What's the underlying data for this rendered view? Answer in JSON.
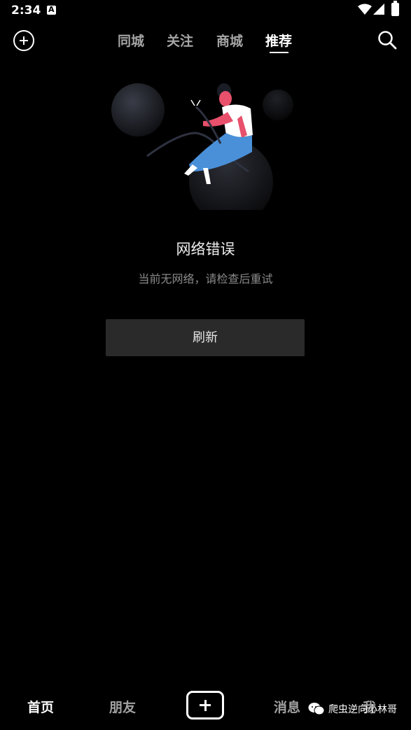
{
  "status_bar": {
    "time": "2:34",
    "notification_letter": "A"
  },
  "top_nav": {
    "tabs": [
      {
        "label": "同城",
        "active": false
      },
      {
        "label": "关注",
        "active": false
      },
      {
        "label": "商城",
        "active": false
      },
      {
        "label": "推荐",
        "active": true
      }
    ]
  },
  "error": {
    "title": "网络错误",
    "subtitle": "当前无网络，请检查后重试",
    "refresh_label": "刷新"
  },
  "bottom_nav": {
    "items": [
      {
        "label": "首页",
        "active": true
      },
      {
        "label": "朋友",
        "active": false
      },
      {
        "label": "消息",
        "active": false
      },
      {
        "label": "我",
        "active": false
      }
    ]
  },
  "watermark": {
    "text": "爬虫逆向小林哥",
    "icon": "wechat-icon"
  },
  "colors": {
    "background": "#000000",
    "button_bg": "#2a2a2a",
    "inactive_text": "#a5a5a5",
    "shirt": "#ffffff",
    "skin": "#e8506b",
    "skirt": "#4a90d9"
  }
}
